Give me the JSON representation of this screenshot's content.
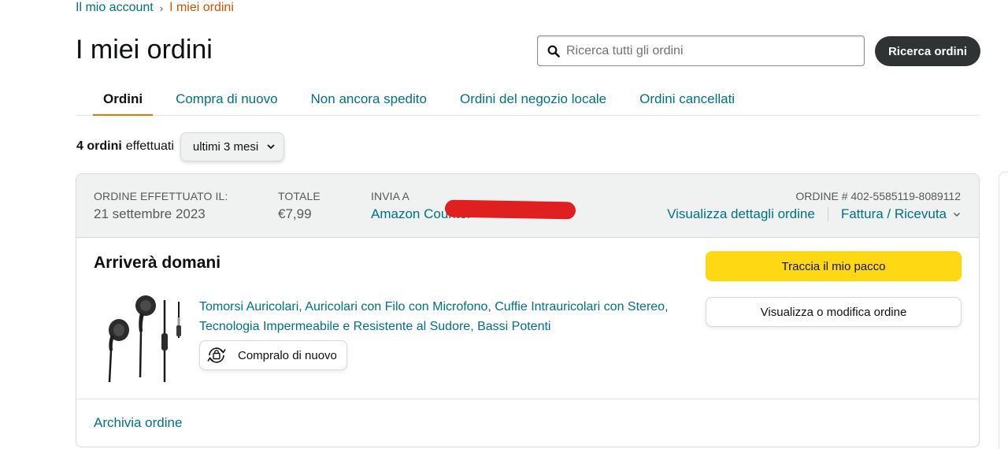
{
  "breadcrumb": {
    "parent": "Il mio account",
    "separator": "›",
    "current": "I miei ordini"
  },
  "page_title": "I miei ordini",
  "search": {
    "placeholder": "Ricerca tutti gli ordini",
    "button_label": "Ricerca ordini"
  },
  "tabs": [
    {
      "label": "Ordini",
      "active": true
    },
    {
      "label": "Compra di nuovo",
      "active": false
    },
    {
      "label": "Non ancora spedito",
      "active": false
    },
    {
      "label": "Ordini del negozio locale",
      "active": false
    },
    {
      "label": "Ordini cancellati",
      "active": false
    }
  ],
  "filter": {
    "count_label": "4 ordini",
    "suffix": "effettuati",
    "period": "ultimi 3 mesi"
  },
  "order": {
    "placed_label": "ORDINE EFFETTUATO IL:",
    "placed_date": "21 settembre 2023",
    "total_label": "TOTALE",
    "total_value": "€7,99",
    "ship_label": "INVIA A",
    "ship_value": "Amazon Counter",
    "order_number": "ORDINE # 402-5585119-8089112",
    "details_link": "Visualizza dettagli ordine",
    "invoice_link": "Fattura / Ricevuta",
    "status": "Arriverà domani",
    "product_title": "Tomorsi Auricolari, Auricolari con Filo con Microfono, Cuffie Intrauricolari con Stereo, Tecnologia Impermeabile e Resistente al Sudore, Bassi Potenti",
    "buy_again_label": "Compralo di nuovo",
    "track_button": "Traccia il mio pacco",
    "view_button": "Visualizza o modifica ordine",
    "archive_link": "Archivia ordine"
  },
  "colors": {
    "link": "#007185",
    "accent_orange": "#c45500",
    "track_yellow": "#ffd814",
    "dark_button": "#303333",
    "header_gray": "#f0f2f2"
  }
}
